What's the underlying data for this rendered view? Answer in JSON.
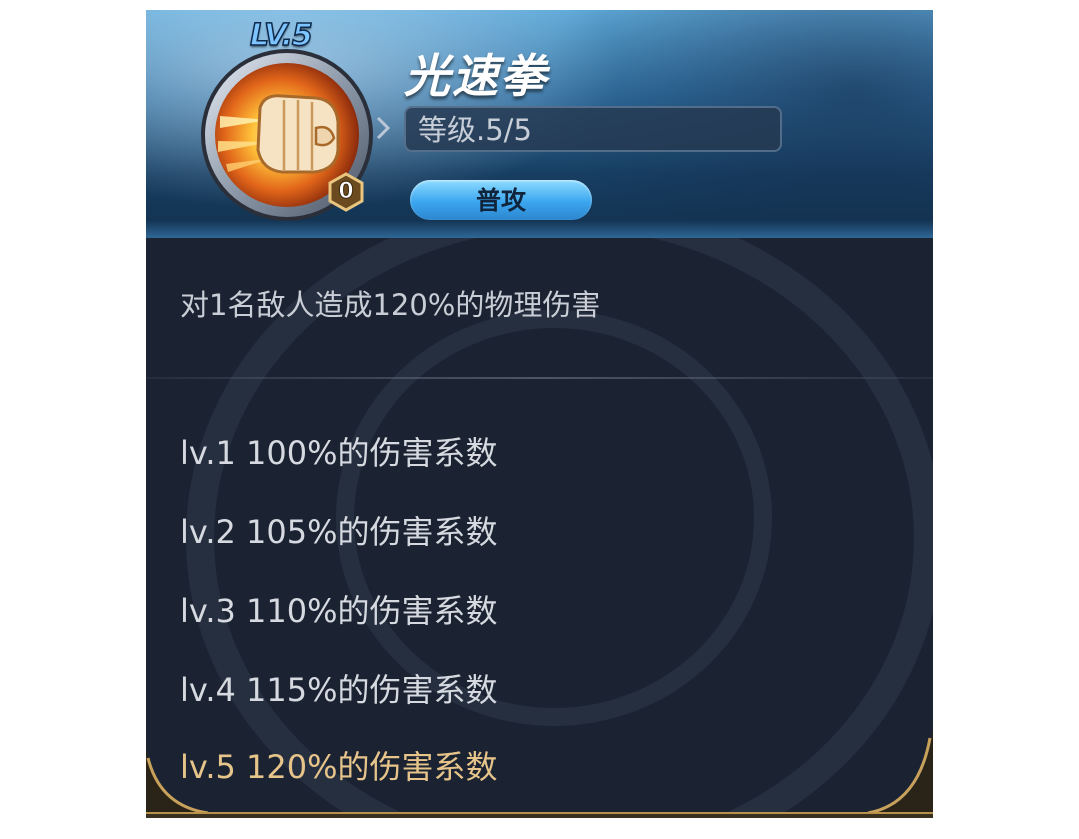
{
  "skill": {
    "level_tag": "LV.5",
    "name": "光速拳",
    "level_text": "等级.5/5",
    "cost": "0",
    "type": "普攻",
    "description": "对1名敌人造成120%的物理伤害",
    "icon": "fist-icon"
  },
  "levels": [
    {
      "text": "lv.1 100%的伤害系数",
      "current": false
    },
    {
      "text": "lv.2 105%的伤害系数",
      "current": false
    },
    {
      "text": "lv.3 110%的伤害系数",
      "current": false
    },
    {
      "text": "lv.4 115%的伤害系数",
      "current": false
    },
    {
      "text": "lv.5 120%的伤害系数",
      "current": true
    }
  ],
  "colors": {
    "panel_bg": "#1b2332",
    "header_blue": "#2f6d9e",
    "pill_blue": "#3ba6ef",
    "current_level": "#e6c48a",
    "text_light": "#d6dae0",
    "gold_trim": "#c8a15a"
  }
}
